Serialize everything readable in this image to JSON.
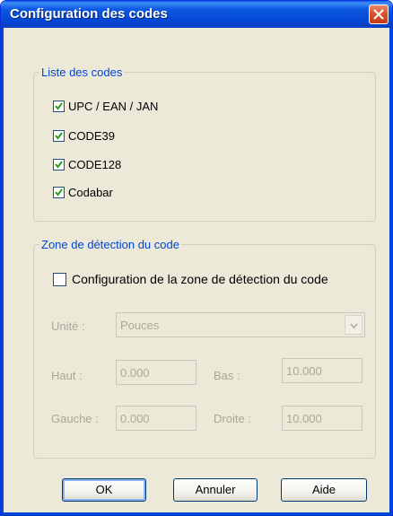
{
  "window": {
    "title": "Configuration des codes"
  },
  "codes_group": {
    "legend": "Liste des codes",
    "items": [
      {
        "label": "UPC / EAN / JAN",
        "checked": true
      },
      {
        "label": "CODE39",
        "checked": true
      },
      {
        "label": "CODE128",
        "checked": true
      },
      {
        "label": "Codabar",
        "checked": true
      }
    ]
  },
  "zone_group": {
    "legend": "Zone de détection du code",
    "config_label": "Configuration de la zone de détection du code",
    "config_checked": false,
    "unit_label": "Unité :",
    "unit_value": "Pouces",
    "haut_label": "Haut :",
    "haut_value": "0.000",
    "bas_label": "Bas :",
    "bas_value": "10.000",
    "gauche_label": "Gauche :",
    "gauche_value": "0.000",
    "droite_label": "Droite :",
    "droite_value": "10.000"
  },
  "buttons": {
    "ok": "OK",
    "cancel": "Annuler",
    "help": "Aide"
  },
  "colors": {
    "accent": "#0046d5",
    "check": "#21a121",
    "titlebar": "#0348d6",
    "close": "#d9532d"
  }
}
